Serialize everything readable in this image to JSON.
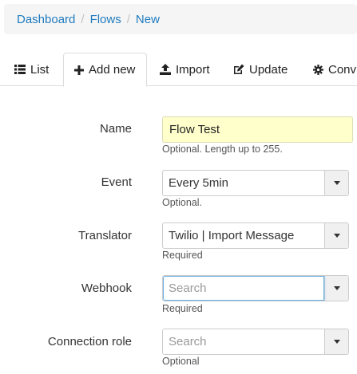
{
  "breadcrumb": {
    "items": [
      "Dashboard",
      "Flows",
      "New"
    ],
    "separator": "/"
  },
  "tabs": [
    {
      "label": "List",
      "icon": "list-icon",
      "active": false
    },
    {
      "label": "Add new",
      "icon": "plus-icon",
      "active": true
    },
    {
      "label": "Import",
      "icon": "upload-icon",
      "active": false
    },
    {
      "label": "Update",
      "icon": "edit-icon",
      "active": false
    },
    {
      "label": "Conv",
      "icon": "gear-icon",
      "active": false
    }
  ],
  "form": {
    "name": {
      "label": "Name",
      "value": "Flow Test",
      "help": "Optional. Length up to 255."
    },
    "event": {
      "label": "Event",
      "value": "Every 5min",
      "help": "Optional."
    },
    "translator": {
      "label": "Translator",
      "value": "Twilio | Import Message",
      "help": "Required"
    },
    "webhook": {
      "label": "Webhook",
      "placeholder": "Search",
      "help": "Required"
    },
    "connection_role": {
      "label": "Connection role",
      "placeholder": "Search",
      "help": "Optional"
    }
  },
  "colors": {
    "link": "#1f7bbf",
    "input_highlight": "#ffffcc",
    "focus_border": "#66afe9"
  }
}
